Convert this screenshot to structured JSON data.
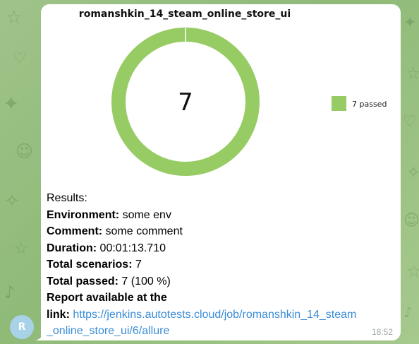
{
  "chat": {
    "avatar_letter": "R",
    "avatar_color": "#a8d2e8",
    "bubble_color": "#ffffff",
    "message_time": "18:52"
  },
  "chart_data": {
    "type": "pie",
    "title": "romanshkin_14_steam_online_store_ui",
    "center_label": "7",
    "legend_placement": "right",
    "slices": [
      {
        "label": "7 passed",
        "value": 7,
        "color": "#97cc64"
      }
    ]
  },
  "report": {
    "results_heading": "Results:",
    "environment_label": "Environment:",
    "environment_value": " some env",
    "comment_label": "Comment:",
    "comment_value": " some comment",
    "duration_label": "Duration:",
    "duration_value": " 00:01:13.710",
    "total_scenarios_label": "Total scenarios:",
    "total_scenarios_value": " 7",
    "total_passed_label": "Total passed:",
    "total_passed_value": " 7 (100 %)",
    "report_label_line1": "Report available at the",
    "report_label_line2": "link:",
    "link_line1": "https://jenkins.autotests.cloud/job/romanshkin_14_steam",
    "link_line2": "_online_store_ui/6/allure"
  }
}
